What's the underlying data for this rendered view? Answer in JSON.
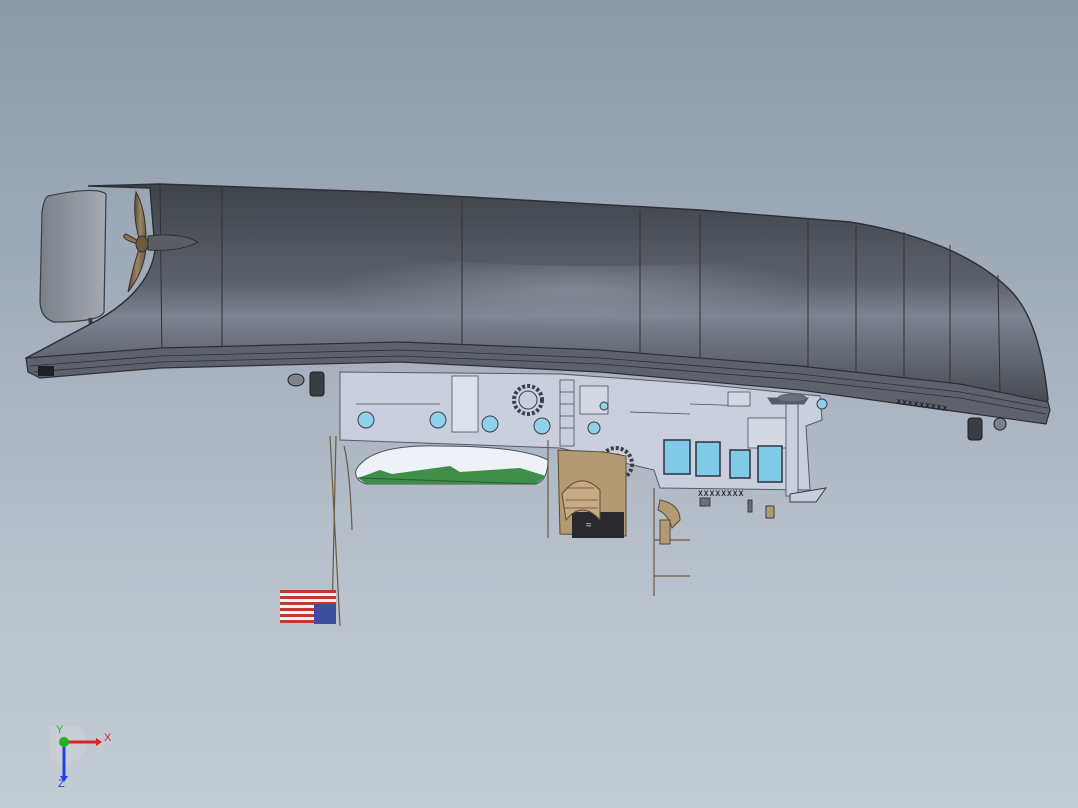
{
  "viewport": {
    "kind": "3d-model-view"
  },
  "model": {
    "parts": [
      "hull",
      "propeller",
      "rudder",
      "superstructure",
      "lifeboat",
      "funnel",
      "flag",
      "mast"
    ],
    "hull_markings": [
      "XXXXXXXXX",
      "XXXXXXXX"
    ],
    "colors": {
      "hull": "#4f535b",
      "hull_highlight": "#8a8f9b",
      "deck_structure": "#c9cfdc",
      "portholes": "#8fd0ea",
      "windows": "#7fcbe8",
      "wood": "#b39a72",
      "funnel_dark": "#2a2a2e",
      "lifeboat_green": "#3f8f4a",
      "flag_red": "#c0392b",
      "flag_blue": "#3b4ea0"
    }
  },
  "triad": {
    "x_label": "X",
    "y_label": "Y",
    "z_label": "Z",
    "colors": {
      "x": "#e02020",
      "y": "#20b020",
      "z": "#2040e0"
    }
  }
}
